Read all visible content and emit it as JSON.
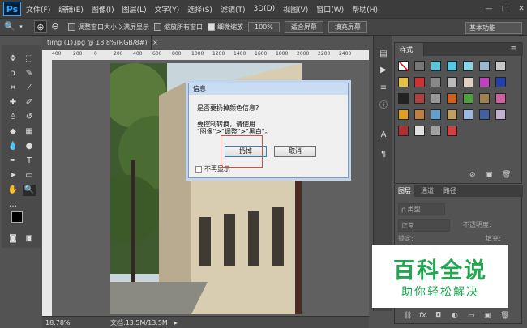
{
  "app": {
    "logo": "Ps",
    "menu": [
      "文件(F)",
      "编辑(E)",
      "图像(I)",
      "图层(L)",
      "文字(Y)",
      "选择(S)",
      "滤镜(T)",
      "3D(D)",
      "视图(V)",
      "窗口(W)",
      "帮助(H)"
    ]
  },
  "options_bar": {
    "resize_windows_label": "调整窗口大小以满屏显示",
    "zoom_all_label": "缩放所有窗口",
    "scrubby_zoom_label": "细微缩放",
    "zoom_100": "100%",
    "fit_screen": "适合屏幕",
    "fill_screen": "填充屏幕",
    "workspace": "基本功能"
  },
  "document": {
    "tab_title": "timg (1).jpg @ 18.8%(RGB/8#)",
    "ruler_ticks": [
      "400",
      "200",
      "0",
      "200",
      "400",
      "600",
      "800",
      "1000",
      "1200",
      "1400",
      "1600",
      "1800",
      "2000",
      "2200",
      "2400"
    ],
    "status_zoom": "18.78%",
    "status_doc": "文档:13.5M/13.5M"
  },
  "dialog": {
    "title": "信息",
    "question": "是否要扔掉颜色信息?",
    "hint_line1": "要控制转换，请使用",
    "hint_line2": "\"图像\">\"调整\">\"黑白\"。",
    "discard_button": "扔掉",
    "cancel_button": "取消",
    "dont_show_label": "不再显示"
  },
  "styles_panel": {
    "tab": "样式"
  },
  "layers_panel": {
    "tabs": [
      "图层",
      "通道",
      "路径"
    ],
    "kind_label": "ρ 类型",
    "blend_mode": "正常",
    "opacity_label": "不透明度:",
    "lock_label": "锁定:",
    "fill_label": "填充:"
  },
  "watermark": {
    "title": "百科全说",
    "subtitle": "助你轻松解决"
  }
}
